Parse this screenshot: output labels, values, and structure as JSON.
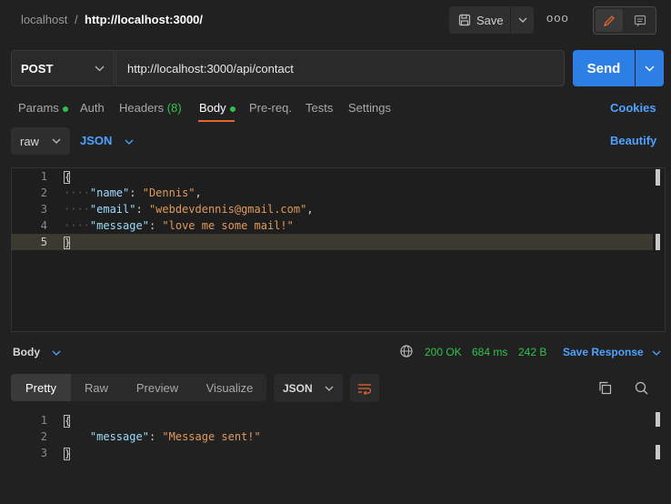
{
  "header": {
    "host": "localhost",
    "separator": "/",
    "url": "http://localhost:3000/",
    "save_label": "Save",
    "more_label": "ooo"
  },
  "request": {
    "method": "POST",
    "url": "http://localhost:3000/api/contact",
    "send_label": "Send"
  },
  "tabs": {
    "params": "Params",
    "auth": "Auth",
    "headers": "Headers",
    "headers_count": "(8)",
    "body": "Body",
    "prereq": "Pre-req.",
    "tests": "Tests",
    "settings": "Settings",
    "cookies": "Cookies"
  },
  "body_type": {
    "mode": "raw",
    "format": "JSON",
    "beautify": "Beautify"
  },
  "request_body": {
    "lines": [
      "1",
      "2",
      "3",
      "4",
      "5"
    ],
    "name_key": "\"name\"",
    "name_val": "\"Dennis\"",
    "email_key": "\"email\"",
    "email_val": "\"webdevdennis@gmail.com\"",
    "message_key": "\"message\"",
    "message_val": "\"love me some mail!\""
  },
  "response": {
    "section": "Body",
    "status": "200 OK",
    "time": "684 ms",
    "size": "242 B",
    "save_response": "Save Response",
    "views": [
      "Pretty",
      "Raw",
      "Preview",
      "Visualize"
    ],
    "format": "JSON",
    "lines": [
      "1",
      "2",
      "3"
    ],
    "message_key": "\"message\"",
    "message_val": "\"Message sent!\""
  },
  "colors": {
    "accent": "#e5642f",
    "primary": "#2d7fe6",
    "success": "#31c24d",
    "link": "#4ea2ff"
  }
}
